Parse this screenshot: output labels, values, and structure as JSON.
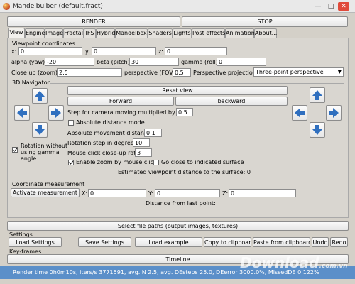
{
  "window": {
    "title": "Mandelbulber (default.fract)"
  },
  "toolbar": {
    "render": "RENDER",
    "stop": "STOP"
  },
  "tabs": [
    "View",
    "Engine",
    "Image",
    "Fractal",
    "IFS",
    "Hybrid",
    "Mandelbox",
    "Shaders",
    "Lights",
    "Post effects",
    "Animation",
    "About..."
  ],
  "viewpoint": {
    "heading": "Viewpoint coordinates",
    "x_label": "x:",
    "x_value": "0",
    "y_label": "y:",
    "y_value": "0",
    "z_label": "z:",
    "z_value": "0",
    "alpha_label": "alpha (yaw):",
    "alpha_value": "-20",
    "beta_label": "beta (pitch):",
    "beta_value": "30",
    "gamma_label": "gamma (roll):",
    "gamma_value": "0",
    "closeup_label": "Close up (zoom):",
    "closeup_value": "2.5",
    "fov_label": "perspective (FOV):",
    "fov_value": "0.5",
    "projection_label": "Perspective projection:",
    "projection_value": "Three-point perspective"
  },
  "navigator": {
    "heading": "3D Navigator",
    "reset_view": "Reset view",
    "forward": "Forward",
    "backward": "backward",
    "step_label": "Step for camera moving multiplied by DE:",
    "step_value": "0.5",
    "absolute_distance_mode": "Absolute distance mode",
    "abs_move_label": "Absolute movement distance:",
    "abs_move_value": "0.1",
    "rotation_step_label": "Rotation step in degrees",
    "rotation_step_value": "10",
    "closeup_ratio_label": "Mouse click close-up ratio",
    "closeup_ratio_value": "3",
    "enable_zoom": "Enable zoom by mouse click",
    "go_close": "Go close to indicated surface",
    "estimated_distance": "Estimated viewpoint distance to the surface: 0",
    "rotation_gamma_line1": "Rotation without",
    "rotation_gamma_line2": "using gamma",
    "rotation_gamma_line3": "angle"
  },
  "measurement": {
    "heading": "Coordinate measurement",
    "activate": "Activate measurement",
    "x_label": "X:",
    "x_value": "0",
    "y_label": "Y:",
    "y_value": "0",
    "z_label": "Z:",
    "z_value": "0",
    "distance_label": "Distance from last point:"
  },
  "file_paths_button": "Select file paths (output images, textures)",
  "settings": {
    "heading": "Settings",
    "load": "Load Settings",
    "save": "Save Settings",
    "load_example": "Load example",
    "copy": "Copy to clipboard",
    "paste": "Paste from clipboard",
    "undo": "Undo",
    "redo": "Redo"
  },
  "keyframes": {
    "heading": "Key-frames",
    "timeline": "Timeline"
  },
  "status": {
    "text": "Render time 0h0m10s, iters/s 3771591, avg. N 2.5, avg. DEsteps 25.0, DEerror 3000.0%, MissedDE 0.122%"
  },
  "watermark": {
    "text": "Download",
    "suffix": ".com.vn"
  },
  "colors": {
    "status_bar": "#5b8fc9",
    "arrow_blue": "#2f6fbf",
    "window_bg": "#d4d0c8"
  }
}
